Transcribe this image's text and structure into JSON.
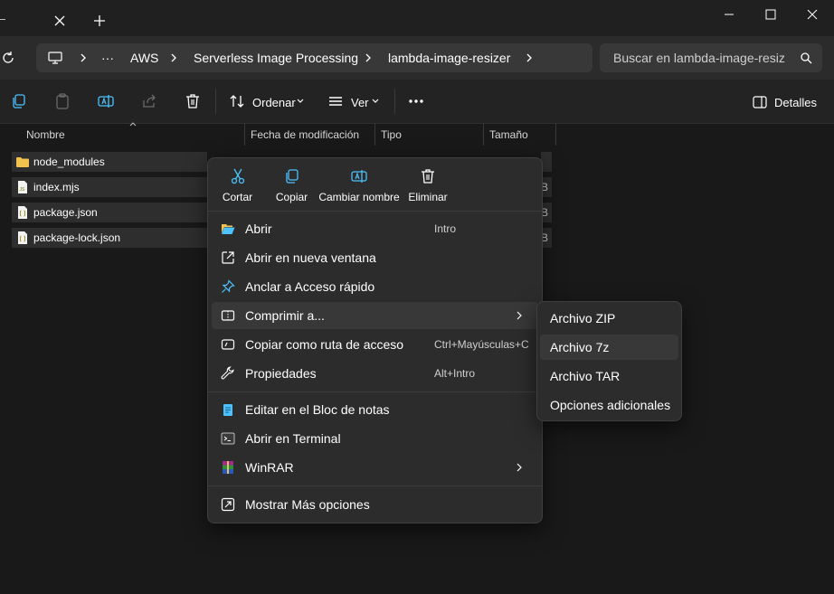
{
  "window": {
    "controls": [
      "minimize",
      "maximize",
      "close"
    ]
  },
  "address": {
    "crumbs": [
      "AWS",
      "Serverless Image Processing",
      "lambda-image-resizer"
    ],
    "search_placeholder": "Buscar en lambda-image-resiz"
  },
  "toolbar": {
    "sort_label": "Ordenar",
    "view_label": "Ver",
    "details_label": "Detalles"
  },
  "columns": [
    "Nombre",
    "Fecha de modificación",
    "Tipo",
    "Tamaño"
  ],
  "files": [
    {
      "name": "node_modules",
      "icon": "folder-icon",
      "size_tail": ""
    },
    {
      "name": "index.mjs",
      "icon": "js-file-icon",
      "size_tail": "B"
    },
    {
      "name": "package.json",
      "icon": "json-file-icon",
      "size_tail": "B"
    },
    {
      "name": "package-lock.json",
      "icon": "json-file-icon",
      "size_tail": "B"
    }
  ],
  "context_menu": {
    "quick_actions": [
      "Cortar",
      "Copiar",
      "Cambiar nombre",
      "Eliminar"
    ],
    "items": [
      {
        "label": "Abrir",
        "shortcut": "Intro"
      },
      {
        "label": "Abrir en nueva ventana",
        "shortcut": ""
      },
      {
        "label": "Anclar a Acceso rápido",
        "shortcut": ""
      },
      {
        "label": "Comprimir a...",
        "shortcut": ""
      },
      {
        "label": "Copiar como ruta de acceso",
        "shortcut": "Ctrl+Mayúsculas+C"
      },
      {
        "label": "Propiedades",
        "shortcut": "Alt+Intro"
      },
      {
        "label": "Editar en el Bloc de notas",
        "shortcut": ""
      },
      {
        "label": "Abrir en Terminal",
        "shortcut": ""
      },
      {
        "label": "WinRAR",
        "shortcut": ""
      },
      {
        "label": "Mostrar Más opciones",
        "shortcut": ""
      }
    ]
  },
  "submenu": {
    "items": [
      "Archivo ZIP",
      "Archivo 7z",
      "Archivo TAR",
      "Opciones adicionales"
    ]
  },
  "colors": {
    "accent": "#4cc2ff",
    "folder": "#f2c14e",
    "background": "#191919",
    "menu": "#2c2c2c"
  }
}
